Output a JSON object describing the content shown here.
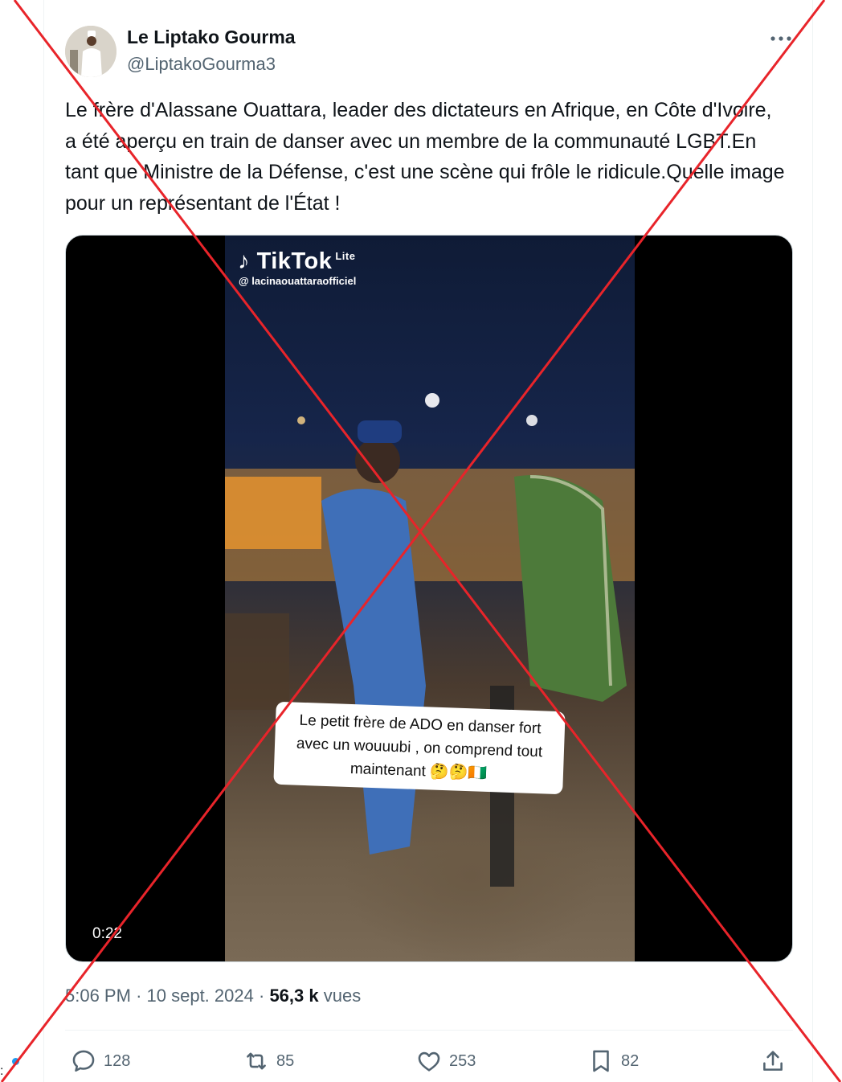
{
  "author": {
    "name": "Le Liptako Gourma",
    "handle": "@LiptakoGourma3"
  },
  "tweet": {
    "text": "Le frère d'Alassane Ouattara, leader des dictateurs en Afrique, en Côte d'Ivoire, a été aperçu en train de danser avec un membre de la communauté LGBT.En tant que Ministre de la Défense, c'est une scène qui frôle le ridicule.Quelle image pour un représentant de l'État !"
  },
  "media": {
    "tiktok_logo": "TikTok",
    "tiktok_lite": "Lite",
    "tiktok_handle": "@ lacinaouattaraofficiel",
    "overlay_caption": "Le petit frère de ADO en danser fort avec un wouuubi , on comprend tout maintenant 🤔🤔🇨🇮",
    "duration": "0:22"
  },
  "meta": {
    "time": "5:06 PM",
    "date": "10 sept. 2024",
    "views_count": "56,3 k",
    "views_label": "vues"
  },
  "actions": {
    "replies": "128",
    "reposts": "85",
    "likes": "253",
    "bookmarks": "82"
  },
  "colors": {
    "cross": "#e8242a",
    "secondary_text": "#536471",
    "accent": "#1d9bf0"
  },
  "icons": [
    "more-icon",
    "reply-icon",
    "repost-icon",
    "like-icon",
    "bookmark-icon",
    "share-icon"
  ]
}
